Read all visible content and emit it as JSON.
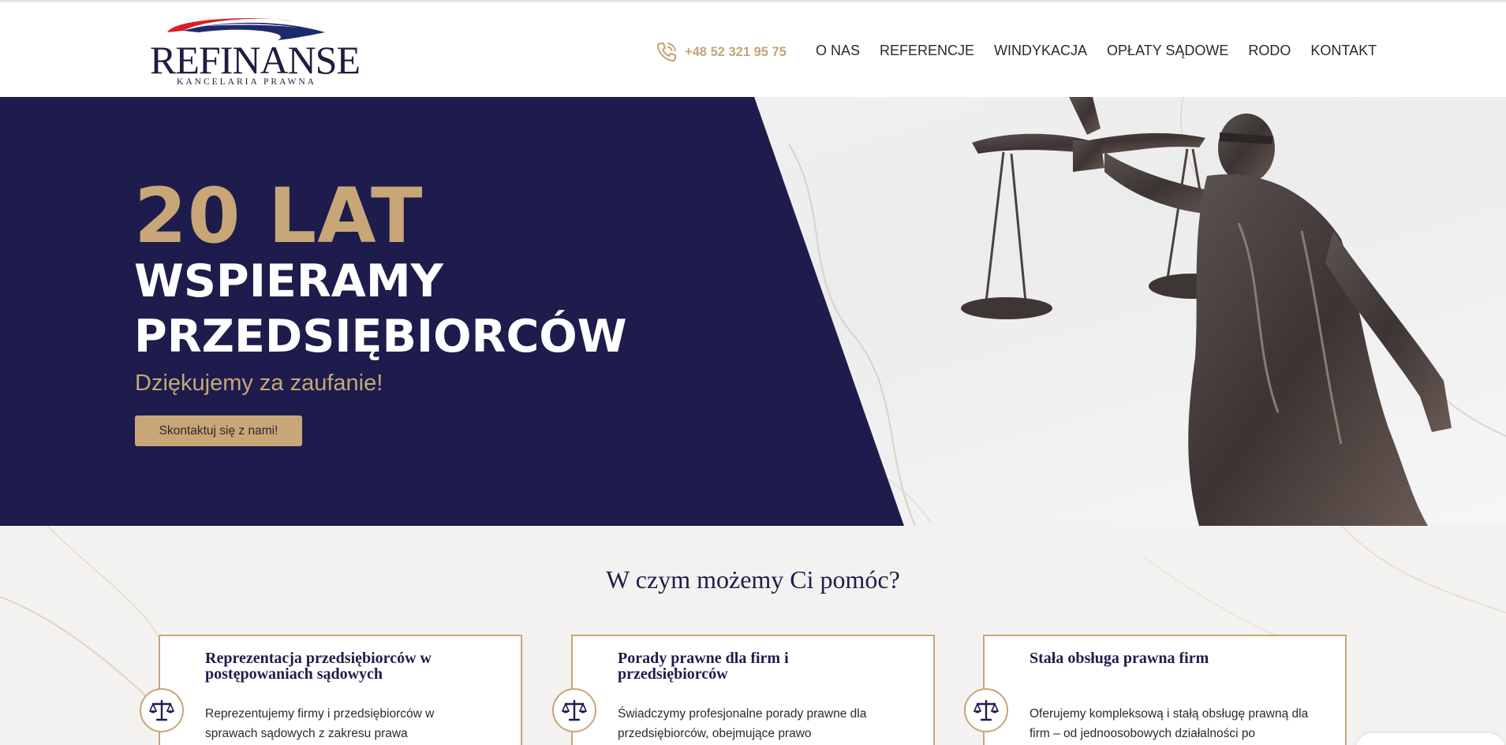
{
  "colors": {
    "navy": "#1d1c4c",
    "gold": "#c8a677",
    "logo_red": "#d81f26",
    "logo_blue": "#1f2a6c"
  },
  "logo": {
    "name": "REFINANSE",
    "subtitle": "KANCELARIA PRAWNA"
  },
  "header": {
    "phone": "+48 52 321 95 75",
    "phone_icon": "phone-icon",
    "nav": [
      {
        "label": "O NAS"
      },
      {
        "label": "REFERENCJE"
      },
      {
        "label": "WINDYKACJA"
      },
      {
        "label": "OPŁATY SĄDOWE"
      },
      {
        "label": "RODO"
      },
      {
        "label": "KONTAKT"
      }
    ]
  },
  "hero": {
    "headline": "20 LAT",
    "line2": "WSPIERAMY",
    "line3": "PRZEDSIĘBIORCÓW",
    "thanks": "Dziękujemy za zaufanie!",
    "cta": "Skontaktuj się z nami!",
    "image": "lady-justice-statue"
  },
  "services": {
    "title": "W czym możemy Ci pomóc?",
    "cards": [
      {
        "icon": "scales-icon",
        "title": "Reprezentacja przedsiębiorców w postępowaniach sądowych",
        "text": "Reprezentujemy firmy i przedsiębiorców w sprawach sądowych z zakresu prawa"
      },
      {
        "icon": "scales-icon",
        "title": "Porady prawne dla firm i przedsiębiorców",
        "text": "Świadczymy profesjonalne porady prawne dla przedsiębiorców, obejmujące prawo"
      },
      {
        "icon": "scales-icon",
        "title": "Stała obsługa prawna firm",
        "text": "Oferujemy kompleksową i stałą obsługę prawną dla firm – od jednoosobowych działalności po"
      }
    ]
  }
}
